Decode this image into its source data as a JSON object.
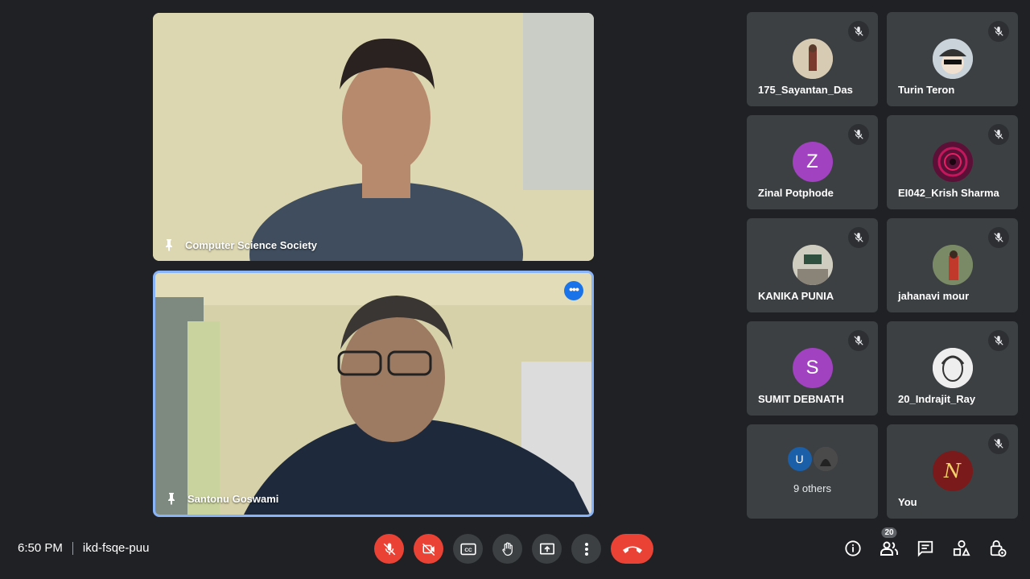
{
  "meeting": {
    "time": "6:50 PM",
    "code": "ikd-fsqe-puu"
  },
  "main_tiles": [
    {
      "name": "Computer Science Society"
    },
    {
      "name": "Santonu Goswami"
    }
  ],
  "participants": [
    {
      "name": "175_Sayantan_Das",
      "avatar_type": "photo",
      "avatar_color": "#c9b8a0"
    },
    {
      "name": "Turin Teron",
      "avatar_type": "photo",
      "avatar_color": "#b9c3c9"
    },
    {
      "name": "Zinal Potphode",
      "avatar_type": "letter",
      "initial": "Z",
      "avatar_color": "#a142c1"
    },
    {
      "name": "EI042_Krish Sharma",
      "avatar_type": "photo",
      "avatar_color": "#7a1d4d"
    },
    {
      "name": "KANIKA PUNIA",
      "avatar_type": "photo",
      "avatar_color": "#b7b4a8"
    },
    {
      "name": "jahanavi mour",
      "avatar_type": "photo",
      "avatar_color": "#6b7a58"
    },
    {
      "name": "SUMIT DEBNATH",
      "avatar_type": "letter",
      "initial": "S",
      "avatar_color": "#a142c1"
    },
    {
      "name": "20_Indrajit_Ray",
      "avatar_type": "photo",
      "avatar_color": "#e6e6e6"
    }
  ],
  "others": {
    "label": "9 others",
    "initial": "U",
    "color": "#1a5fa8"
  },
  "self": {
    "name": "You",
    "avatar_color": "#7a1a1a",
    "initial": "N"
  },
  "participant_count": "20",
  "icons": {
    "mic": "mic-off-icon",
    "camera": "camera-off-icon",
    "captions": "captions-icon",
    "hand": "raise-hand-icon",
    "present": "present-icon",
    "more": "more-vert-icon",
    "end": "end-call-icon",
    "info": "info-icon",
    "people": "people-icon",
    "chat": "chat-icon",
    "activities": "activities-icon",
    "host": "host-controls-icon"
  }
}
